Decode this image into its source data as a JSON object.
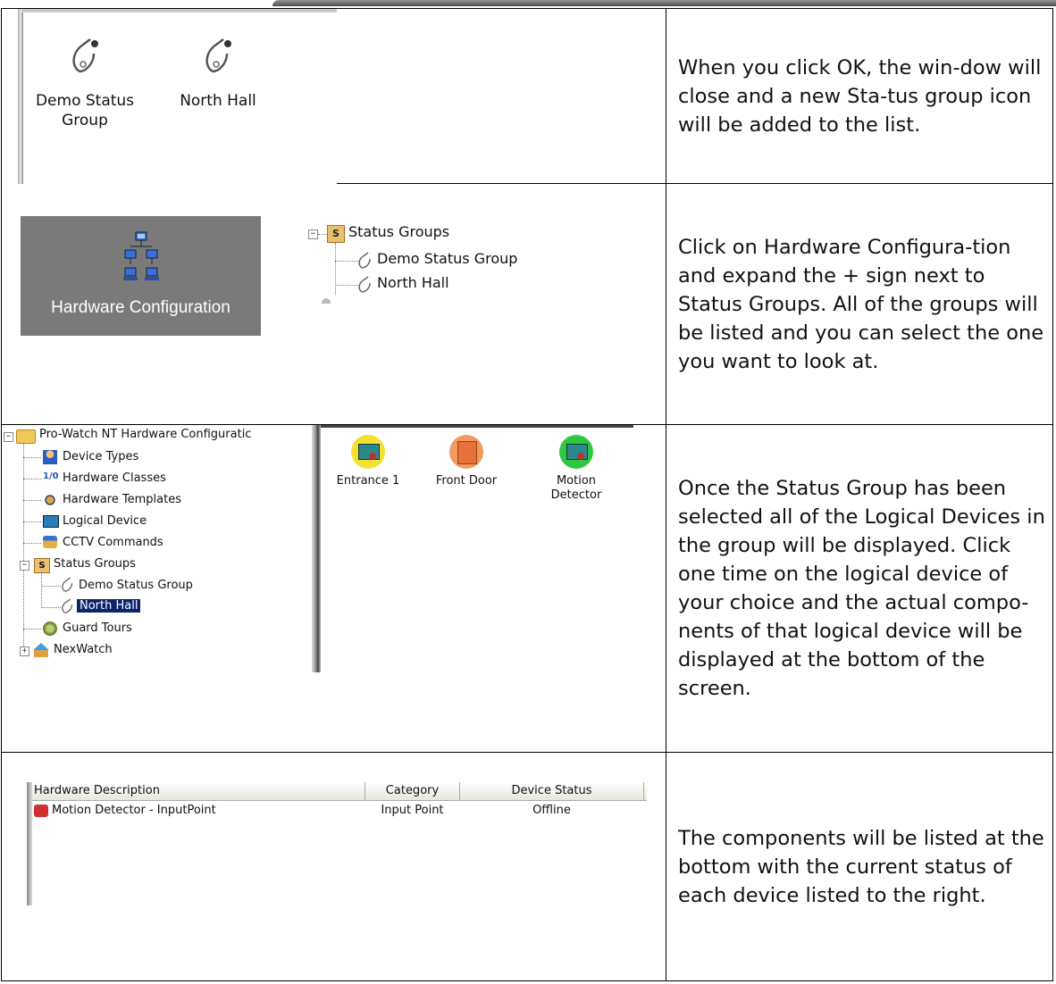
{
  "rows": [
    {
      "text": "When you click OK, the win-dow will close and a new Sta-tus group icon will be added to the list.",
      "icons": [
        "Demo Status Group",
        "North Hall"
      ]
    },
    {
      "text": "Click on Hardware Configura-tion and expand the + sign next to Status Groups. All of the groups will be listed and you can select the one you want to look at.",
      "panel_label": "Hardware Configuration",
      "tree": {
        "parent": "Status Groups",
        "children": [
          "Demo Status Group",
          "North Hall"
        ]
      }
    },
    {
      "text": "Once the Status Group has been selected all of the Logical Devices in the group will be displayed. Click one time on the logical device of your choice and the actual compo-nents of that logical device will be displayed at the bottom of the screen.",
      "tree_root": "Pro-Watch NT Hardware Configuratic",
      "tree_items": [
        "Device Types",
        "Hardware Classes",
        "Hardware Templates",
        "Logical Device",
        "CCTV Commands",
        "Status Groups",
        "Demo Status Group",
        "North Hall",
        "Guard Tours",
        "NexWatch"
      ],
      "devices": [
        "Entrance 1",
        "Front Door",
        "Motion Detector"
      ]
    },
    {
      "text": "The components will be listed at the bottom with the current status of each device listed to the right.",
      "columns": [
        "Hardware Description",
        "Category",
        "Device Status"
      ],
      "row": [
        "Motion Detector - InputPoint",
        "Input Point",
        "Offline"
      ]
    }
  ],
  "colors": {
    "selection": "#0a246a",
    "panel_gray": "#7a7a7a",
    "border": "#000000"
  },
  "icons": {
    "status_group": "stethoscope-icon",
    "hardware_config": "network-icon",
    "folder": "folder-icon",
    "device": "device-icon",
    "input_point": "input-point-icon"
  }
}
